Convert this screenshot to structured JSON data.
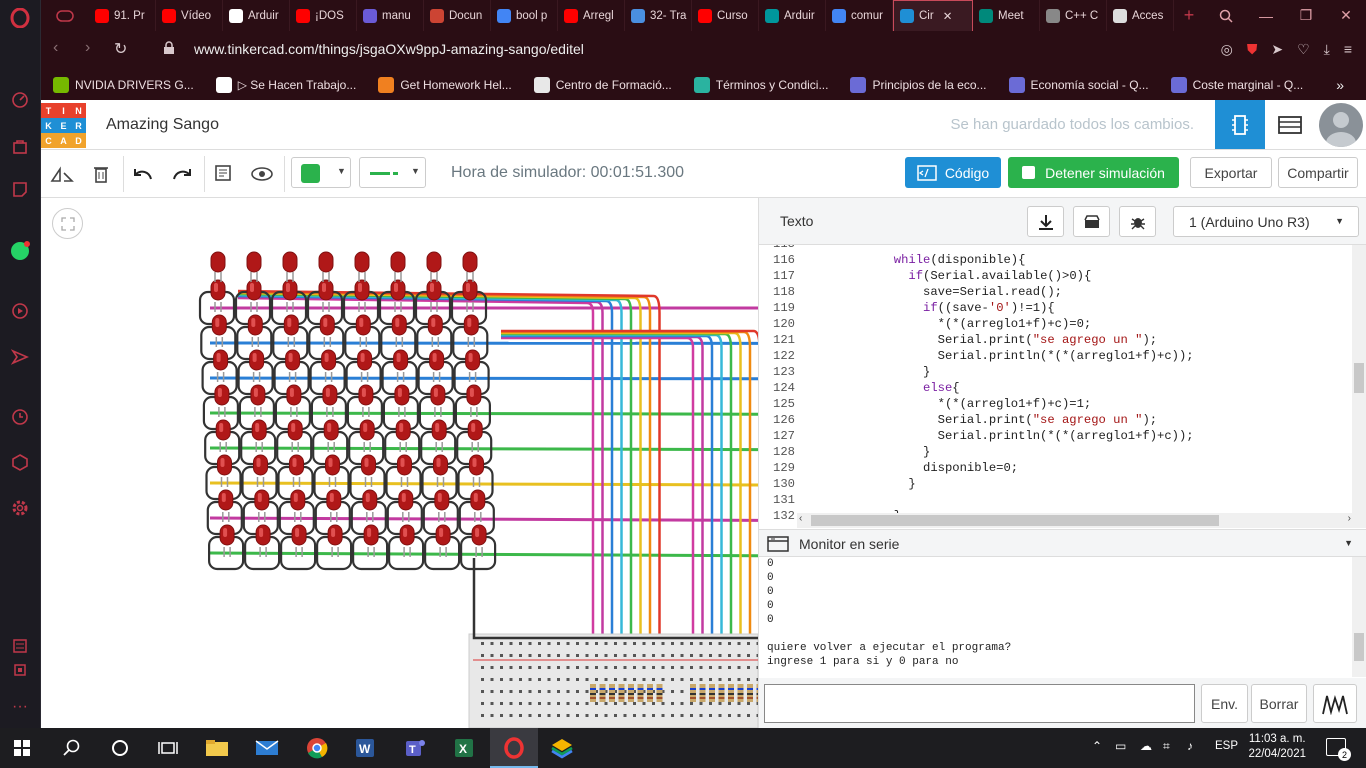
{
  "browser": {
    "tabs": [
      {
        "label": "91. Pr",
        "color": "#ff0000"
      },
      {
        "label": "Vídeo",
        "color": "#ff0000"
      },
      {
        "label": "Arduir",
        "color": "#ffffff"
      },
      {
        "label": "¡DOS",
        "color": "#ff0000"
      },
      {
        "label": "manu",
        "color": "#6b5bd6"
      },
      {
        "label": "Docun",
        "color": "#c43"
      },
      {
        "label": "bool p",
        "color": "#4285f4"
      },
      {
        "label": "Arregl",
        "color": "#ff0000"
      },
      {
        "label": "32- Tra",
        "color": "#4a8fe0"
      },
      {
        "label": "Curso",
        "color": "#ff0000"
      },
      {
        "label": "Arduir",
        "color": "#00979c"
      },
      {
        "label": "comur",
        "color": "#4285f4"
      },
      {
        "label": "Cir",
        "color": "#1f8fd5"
      },
      {
        "label": "Meet",
        "color": "#00897b"
      },
      {
        "label": "C++ C",
        "color": "#888888"
      },
      {
        "label": "Acces",
        "color": "#dddddd"
      }
    ],
    "active_tab_close": "✕",
    "new_tab": "+",
    "url": "www.tinkercad.com/things/jsgaOXw9ppJ-amazing-sango/editel",
    "bookmarks": [
      {
        "label": "NVIDIA DRIVERS G...",
        "color": "#76b900"
      },
      {
        "label": "▷ Se Hacen Trabajo...",
        "color": "#ffffff"
      },
      {
        "label": "Get Homework Hel...",
        "color": "#f08020"
      },
      {
        "label": "Centro de Formació...",
        "color": "#e8e8e8"
      },
      {
        "label": "Términos y Condici...",
        "color": "#2ab3a0"
      },
      {
        "label": "Principios de la eco...",
        "color": "#6b6bd6"
      },
      {
        "label": "Economía social - Q...",
        "color": "#6b6bd6"
      },
      {
        "label": "Coste marginal - Q...",
        "color": "#6b6bd6"
      }
    ],
    "bookmarks_more": "»"
  },
  "tinkercad": {
    "logo_letters": [
      "T",
      "I",
      "N",
      "K",
      "E",
      "R",
      "C",
      "A",
      "D"
    ],
    "logo_colors": [
      "#e8412c",
      "#e8412c",
      "#e8412c",
      "#1f8fd5",
      "#1f8fd5",
      "#1f8fd5",
      "#f1a32c",
      "#f1a32c",
      "#f1a32c"
    ],
    "project_name": "Amazing Sango",
    "save_status": "Se han guardado todos los cambios.",
    "sim_time": "Hora de simulador: 00:01:51.300",
    "code_button": "Código",
    "stop_button": "Detener simulación",
    "export_button": "Exportar",
    "share_button": "Compartir",
    "fill_color": "#2bb24c",
    "wire_color": "#2bb24c"
  },
  "code_panel": {
    "mode": "Texto",
    "board": "1 (Arduino Uno R3)",
    "lines": [
      {
        "n": "115",
        "code": ""
      },
      {
        "n": "116",
        "code": "            while(disponible){"
      },
      {
        "n": "117",
        "code": "              if(Serial.available()>0){"
      },
      {
        "n": "118",
        "code": "                save=Serial.read();"
      },
      {
        "n": "119",
        "code": "                if((save-'0')!=1){"
      },
      {
        "n": "120",
        "code": "                  *(*(arreglo1+f)+c)=0;"
      },
      {
        "n": "121",
        "code": "                  Serial.print(\"se agrego un \");"
      },
      {
        "n": "122",
        "code": "                  Serial.println(*(*(arreglo1+f)+c));"
      },
      {
        "n": "123",
        "code": "                }"
      },
      {
        "n": "124",
        "code": "                else{"
      },
      {
        "n": "125",
        "code": "                  *(*(arreglo1+f)+c)=1;"
      },
      {
        "n": "126",
        "code": "                  Serial.print(\"se agrego un \");"
      },
      {
        "n": "127",
        "code": "                  Serial.println(*(*(arreglo1+f)+c));"
      },
      {
        "n": "128",
        "code": "                }"
      },
      {
        "n": "129",
        "code": "                disponible=0;"
      },
      {
        "n": "130",
        "code": "              }"
      },
      {
        "n": "131",
        "code": ""
      },
      {
        "n": "132",
        "code": "            }"
      }
    ],
    "serial_title": "Monitor en serie",
    "serial_lines": [
      "0",
      "0",
      "0",
      "0",
      "0",
      "",
      "quiere volver a ejecutar el programa?",
      "ingrese 1 para si y 0 para no"
    ],
    "send_button": "Env.",
    "clear_button": "Borrar"
  },
  "taskbar": {
    "lang": "ESP",
    "time": "11:03 a. m.",
    "date": "22/04/2021",
    "notifications": "2"
  }
}
